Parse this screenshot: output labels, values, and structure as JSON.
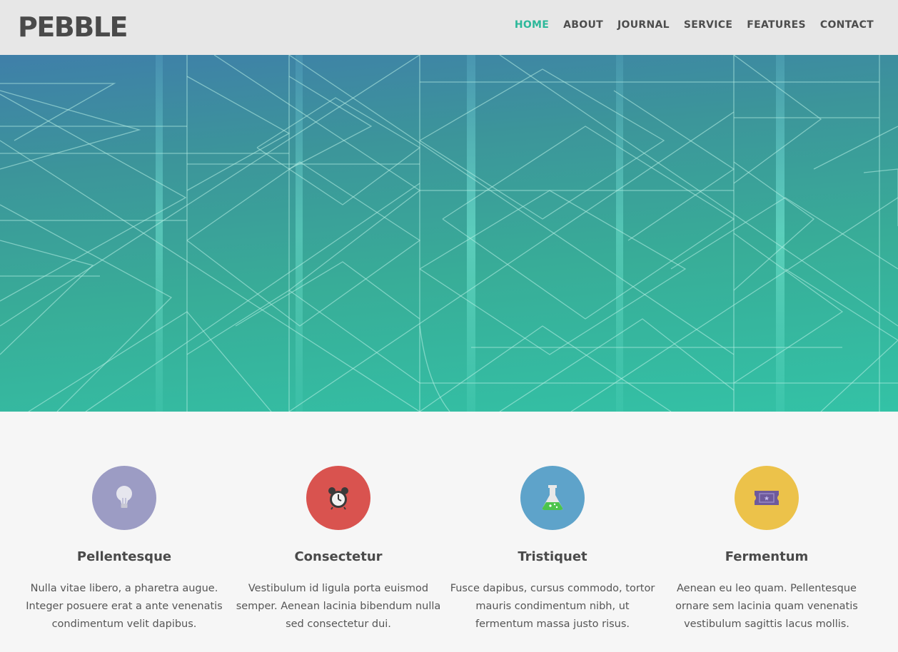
{
  "header": {
    "logo": "PEBBLE",
    "nav": [
      {
        "label": "HOME",
        "active": true
      },
      {
        "label": "ABOUT",
        "active": false
      },
      {
        "label": "JOURNAL",
        "active": false
      },
      {
        "label": "SERVICE",
        "active": false
      },
      {
        "label": "FEATURES",
        "active": false
      },
      {
        "label": "CONTACT",
        "active": false
      }
    ]
  },
  "colors": {
    "accent": "#2cb89a",
    "lavender": "#9c9cc4",
    "red": "#d9534f",
    "blue": "#5ea3ca",
    "yellow": "#ecc24a"
  },
  "features": [
    {
      "icon": "lightbulb-icon",
      "title": "Pellentesque",
      "text": "Nulla vitae libero, a pharetra augue. Integer posuere erat a ante venenatis condimentum velit dapibus."
    },
    {
      "icon": "alarm-clock-icon",
      "title": "Consectetur",
      "text": "Vestibulum id ligula porta euismod semper. Aenean lacinia bibendum nulla sed consectetur dui."
    },
    {
      "icon": "flask-icon",
      "title": "Tristiquet",
      "text": "Fusce dapibus, cursus commodo, tortor mauris condimentum nibh, ut fermentum massa justo risus."
    },
    {
      "icon": "ticket-icon",
      "title": "Fermentum",
      "text": "Aenean eu leo quam. Pellentesque ornare sem lacinia quam venenatis vestibulum sagittis lacus mollis."
    }
  ]
}
